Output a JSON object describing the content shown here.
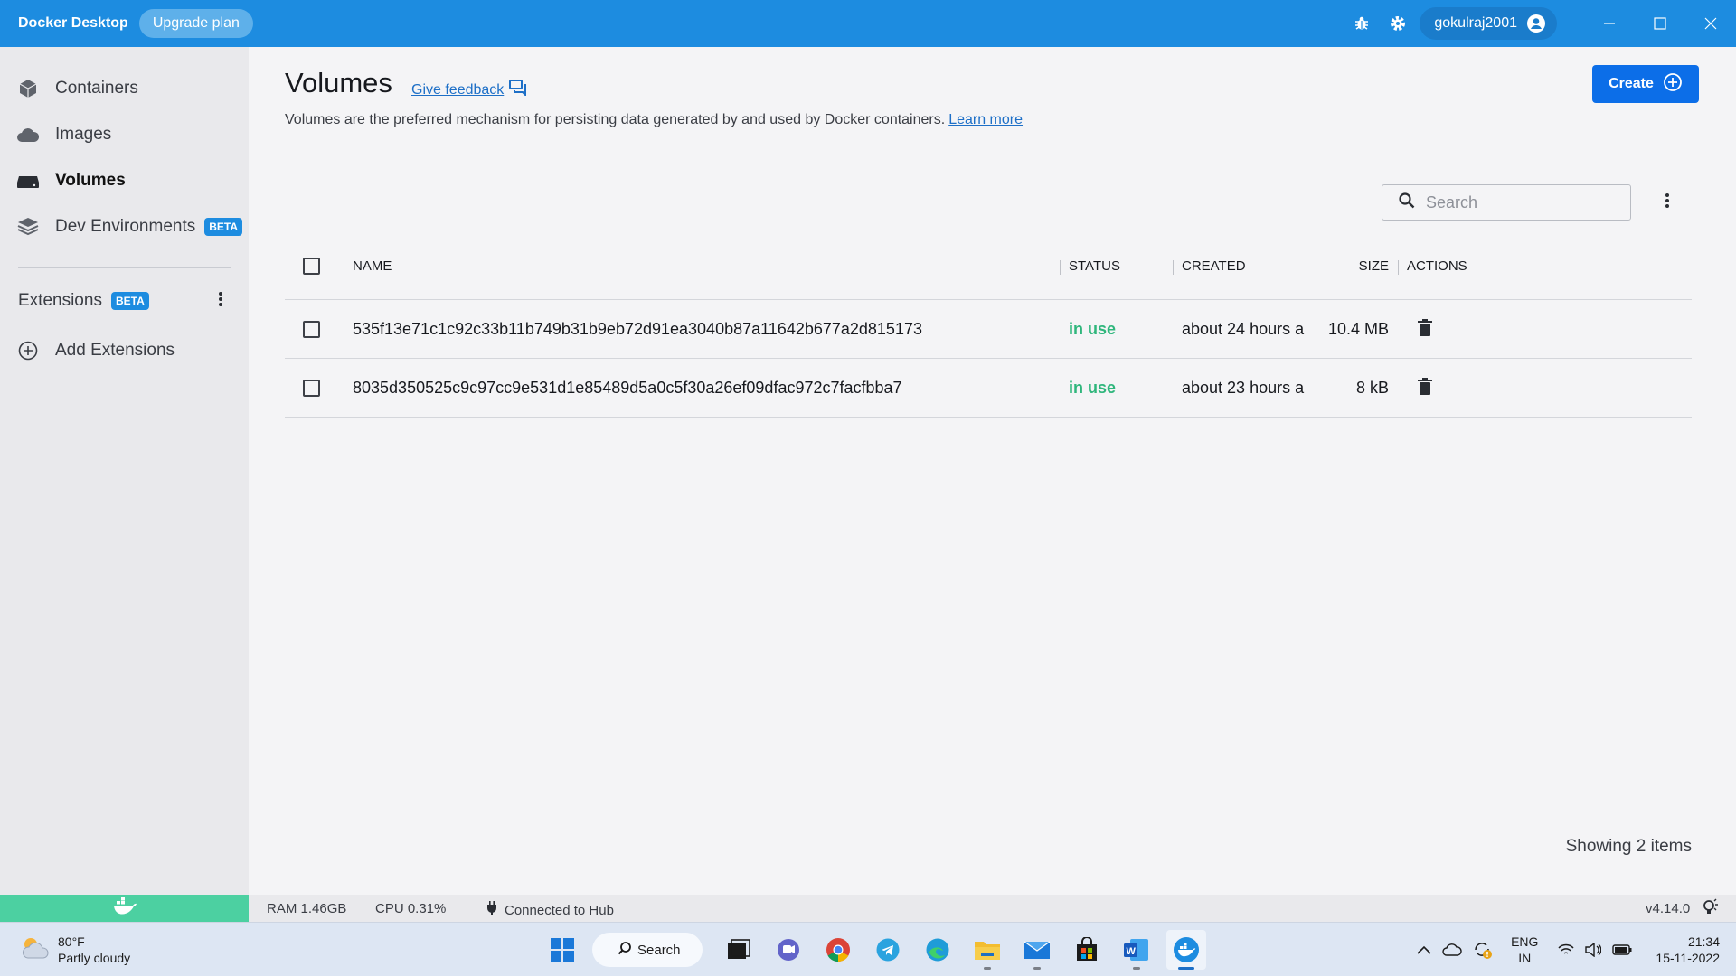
{
  "app": {
    "title": "Docker Desktop",
    "upgrade_label": "Upgrade plan",
    "username": "gokulraj2001"
  },
  "sidebar": {
    "items": [
      {
        "label": "Containers",
        "icon": "containers-icon"
      },
      {
        "label": "Images",
        "icon": "cloud-icon"
      },
      {
        "label": "Volumes",
        "icon": "volume-drive-icon",
        "active": true
      },
      {
        "label": "Dev Environments",
        "icon": "dev-environments-icon",
        "badge": "BETA"
      }
    ],
    "extensions_label": "Extensions",
    "extensions_badge": "BETA",
    "add_extensions_label": "Add Extensions"
  },
  "page": {
    "title": "Volumes",
    "feedback_label": "Give feedback",
    "description": "Volumes are the preferred mechanism for persisting data generated by and used by Docker containers.",
    "learn_more": "Learn more",
    "create_label": "Create",
    "search_placeholder": "Search",
    "showing": "Showing 2 items"
  },
  "table": {
    "columns": {
      "name": "NAME",
      "status": "STATUS",
      "created": "CREATED",
      "size": "SIZE",
      "actions": "ACTIONS"
    },
    "rows": [
      {
        "name": "535f13e71c1c92c33b11b749b31b9eb72d91ea3040b87a11642b677a2d815173",
        "status": "in use",
        "created": "about 24 hours a",
        "size": "10.4 MB"
      },
      {
        "name": "8035d350525c9c97cc9e531d1e85489d5a0c5f30a26ef09dfac972c7facfbba7",
        "status": "in use",
        "created": "about 23 hours a",
        "size": "8 kB"
      }
    ]
  },
  "statusbar": {
    "ram": "RAM 1.46GB",
    "cpu": "CPU 0.31%",
    "hub": "Connected to Hub",
    "version": "v4.14.0"
  },
  "taskbar": {
    "weather_temp": "80°F",
    "weather_desc": "Partly cloudy",
    "search_label": "Search",
    "lang_1": "ENG",
    "lang_2": "IN",
    "time": "21:34",
    "date": "15-11-2022"
  },
  "colors": {
    "titlebar": "#1d8ce0",
    "primary_button": "#0c6ee8",
    "in_use": "#2fb67c",
    "whale_block": "#4cd0a1"
  }
}
